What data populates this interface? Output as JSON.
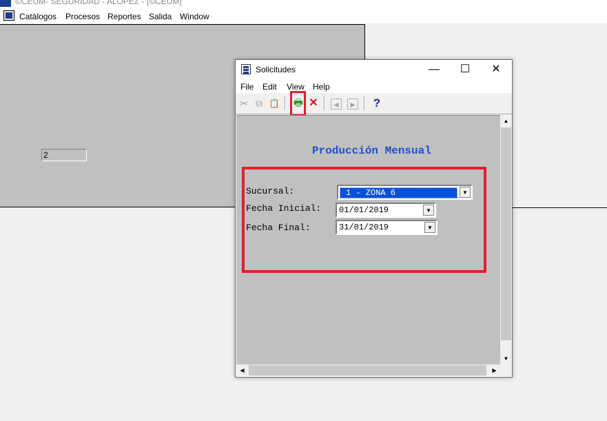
{
  "app": {
    "title": "©CEUM- SEGURIDAD - ALOPEZ - [©CEUM]",
    "menu": [
      "Catálogos",
      "Procesos",
      "Reportes",
      "Salida",
      "Window"
    ]
  },
  "background_window": {
    "field_value": "2"
  },
  "dialog": {
    "title": "Solicitudes",
    "window_buttons": {
      "minimize": "—",
      "maximize": "☐",
      "close": "✕"
    },
    "menu": [
      "File",
      "Edit",
      "View",
      "Help"
    ],
    "toolbar": {
      "cut_icon": "✂",
      "copy_icon": "⧉",
      "paste_icon": "📋",
      "print_icon": "🖶",
      "cancel_icon": "✕",
      "prev_icon": "◂",
      "next_icon": "▸",
      "help_icon": "?"
    },
    "heading": "Producción Mensual",
    "fields": {
      "sucursal": {
        "label": "Sucursal:",
        "value": "1 - ZONA 6"
      },
      "fecha_inicial": {
        "label": "Fecha Inicial:",
        "value": "01/01/2019"
      },
      "fecha_final": {
        "label": "Fecha Final:",
        "value": "31/01/2019"
      }
    },
    "colors": {
      "heading": "#1f4fc9",
      "highlight": "#e0202c",
      "selection": "#0a50d8"
    }
  }
}
